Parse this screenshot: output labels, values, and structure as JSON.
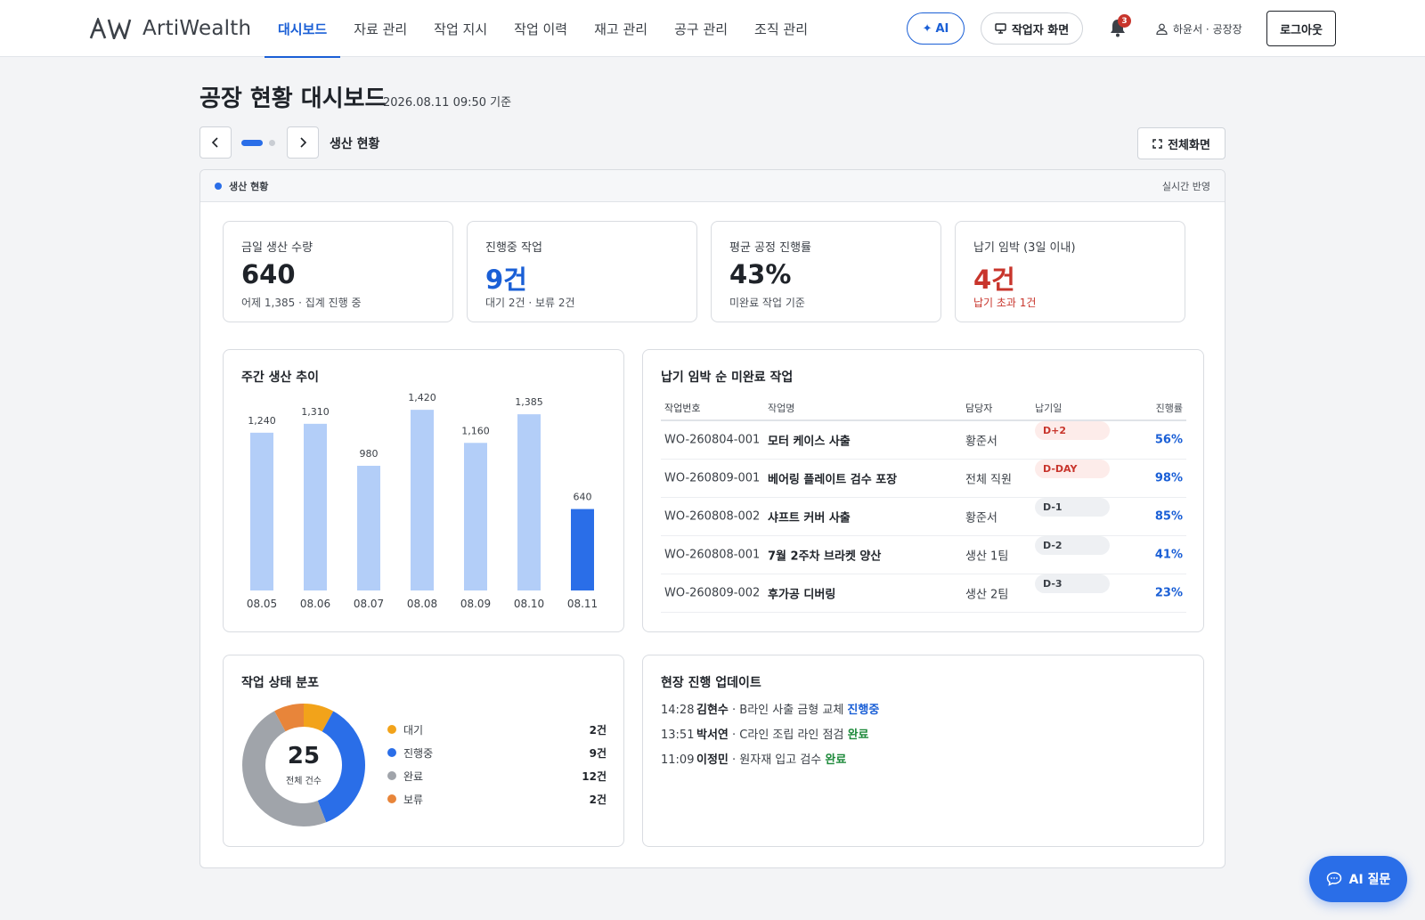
{
  "app": {
    "logo_text": "ArtiWealth",
    "logo_mark": "AW"
  },
  "nav": {
    "items": [
      "대시보드",
      "자료 관리",
      "작업 지시",
      "작업 이력",
      "재고 관리",
      "공구 관리",
      "조직 관리"
    ],
    "active_index": 0
  },
  "topbar": {
    "ai_label": "AI",
    "worker_screen_label": "작업자 화면",
    "notification_count": "3",
    "user_label": "하윤서 · 공장장",
    "logout_label": "로그아웃"
  },
  "header": {
    "title": "공장 현황 대시보드",
    "timestamp": "2026.08.11 09:50 기준",
    "section_name": "생산 현황",
    "fullscreen_label": "전체화면",
    "slide_count": 2,
    "active_slide": 1
  },
  "panel": {
    "label": "생산 현황",
    "realtime": "실시간 반영"
  },
  "kpis": [
    {
      "label": "금일 생산 수량",
      "value": "640",
      "sub": "어제 1,385 · 집계 진행 중",
      "tone": "default"
    },
    {
      "label": "진행중 작업",
      "value": "9건",
      "sub": "대기 2건 · 보류 2건",
      "tone": "blue"
    },
    {
      "label": "평균 공정 진행률",
      "value": "43%",
      "sub": "미완료 작업 기준",
      "tone": "default"
    },
    {
      "label": "납기 임박 (3일 이내)",
      "value": "4건",
      "sub": "납기 초과 1건",
      "tone": "red"
    }
  ],
  "weekly_chart_title": "주간 생산 추이",
  "chart_data": {
    "type": "bar",
    "title": "주간 생산 추이",
    "categories": [
      "08.05",
      "08.06",
      "08.07",
      "08.08",
      "08.09",
      "08.10",
      "08.11"
    ],
    "values": [
      1240,
      1310,
      980,
      1420,
      1160,
      1385,
      640
    ],
    "value_labels": [
      "1,240",
      "1,310",
      "980",
      "1,420",
      "1,160",
      "1,385",
      "640"
    ],
    "highlight_index": 6,
    "colors": {
      "normal": "#b3cef8",
      "highlight": "#2a6ee8"
    },
    "xlabel": "",
    "ylabel": ""
  },
  "orders": {
    "title": "납기 임박 순 미완료 작업",
    "columns": [
      "작업번호",
      "작업명",
      "담당자",
      "납기일",
      "진행률"
    ],
    "rows": [
      {
        "id": "WO-260804-001",
        "name": "모터 케이스 사출",
        "owner": "황준서",
        "due": "D+2",
        "urgent": true,
        "progress": "56%"
      },
      {
        "id": "WO-260809-001",
        "name": "베어링 플레이트 검수 포장",
        "owner": "전체 직원",
        "due": "D-DAY",
        "urgent": true,
        "progress": "98%"
      },
      {
        "id": "WO-260808-002",
        "name": "샤프트 커버 사출",
        "owner": "황준서",
        "due": "D-1",
        "urgent": false,
        "progress": "85%"
      },
      {
        "id": "WO-260808-001",
        "name": "7월 2주차 브라켓 양산",
        "owner": "생산 1팀",
        "due": "D-2",
        "urgent": false,
        "progress": "41%"
      },
      {
        "id": "WO-260809-002",
        "name": "후가공 디버링",
        "owner": "생산 2팀",
        "due": "D-3",
        "urgent": false,
        "progress": "23%"
      }
    ]
  },
  "status_dist": {
    "title": "작업 상태 분포",
    "total": "25",
    "total_label": "전체 건수",
    "items": [
      {
        "label": "대기",
        "count": 2,
        "count_label": "2건",
        "color": "#f2a31a"
      },
      {
        "label": "진행중",
        "count": 9,
        "count_label": "9건",
        "color": "#2a6ee8"
      },
      {
        "label": "완료",
        "count": 12,
        "count_label": "12건",
        "color": "#a0a4aa"
      },
      {
        "label": "보류",
        "count": 2,
        "count_label": "2건",
        "color": "#e8853a"
      }
    ]
  },
  "updates": {
    "title": "현장 진행 업데이트",
    "items": [
      {
        "time": "14:28",
        "worker": "김현수",
        "text": " · B라인 사출 금형 교체 ",
        "status": "진행중",
        "tone": "blue"
      },
      {
        "time": "13:51",
        "worker": "박서연",
        "text": " · C라인 조립 라인 점검 ",
        "status": "완료",
        "tone": "green"
      },
      {
        "time": "11:09",
        "worker": "이정민",
        "text": " · 원자재 입고 검수 ",
        "status": "완료",
        "tone": "green"
      }
    ]
  },
  "fab": {
    "label": "AI 질문"
  }
}
